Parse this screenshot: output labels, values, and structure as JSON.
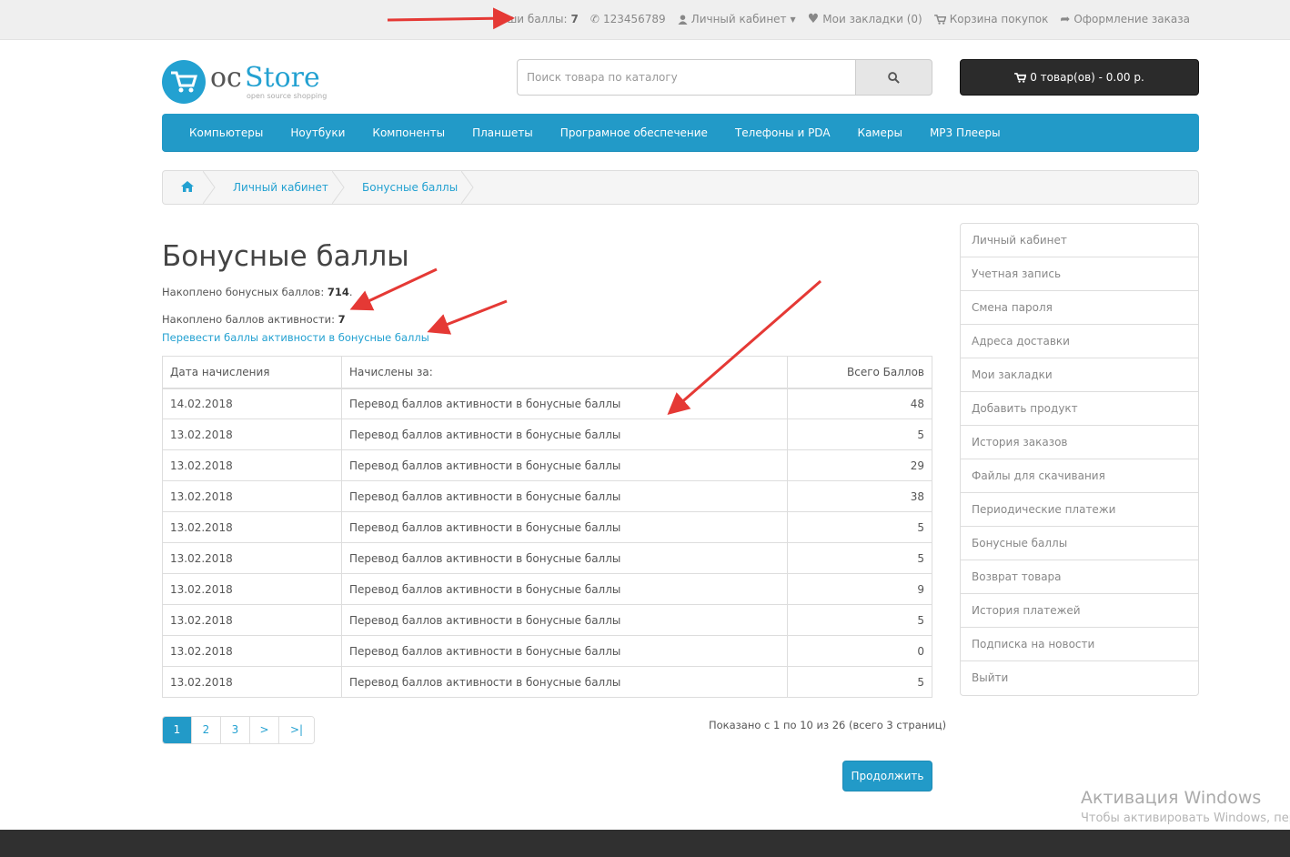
{
  "topbar": {
    "points_label": "Ваши баллы:",
    "points_value": "7",
    "phone": "123456789",
    "account": "Личный кабинет",
    "wishlist": "Мои закладки (0)",
    "cart": "Корзина покупок",
    "checkout": "Оформление заказа"
  },
  "logo": {
    "oc": "oc",
    "store": "Store",
    "tagline": "open source shopping"
  },
  "search": {
    "placeholder": "Поиск товара по каталогу"
  },
  "cart_button": {
    "label": "0 товар(ов) - 0.00 р."
  },
  "menu": [
    "Компьютеры",
    "Ноутбуки",
    "Компоненты",
    "Планшеты",
    "Програмное обеспечение",
    "Телефоны и PDA",
    "Камеры",
    "MP3 Плееры"
  ],
  "breadcrumb": [
    "Личный кабинет",
    "Бонусные баллы"
  ],
  "page": {
    "title": "Бонусные баллы",
    "bonus_label": "Накоплено бонусных баллов:",
    "bonus_value": "714",
    "activity_label": "Накоплено баллов активности:",
    "activity_value": "7",
    "convert_link": "Перевести баллы активности в бонусные баллы"
  },
  "table": {
    "headers": [
      "Дата начисления",
      "Начислены за:",
      "Всего Баллов"
    ],
    "rows": [
      [
        "14.02.2018",
        "Перевод баллов активности в бонусные баллы",
        "48"
      ],
      [
        "13.02.2018",
        "Перевод баллов активности в бонусные баллы",
        "5"
      ],
      [
        "13.02.2018",
        "Перевод баллов активности в бонусные баллы",
        "29"
      ],
      [
        "13.02.2018",
        "Перевод баллов активности в бонусные баллы",
        "38"
      ],
      [
        "13.02.2018",
        "Перевод баллов активности в бонусные баллы",
        "5"
      ],
      [
        "13.02.2018",
        "Перевод баллов активности в бонусные баллы",
        "5"
      ],
      [
        "13.02.2018",
        "Перевод баллов активности в бонусные баллы",
        "9"
      ],
      [
        "13.02.2018",
        "Перевод баллов активности в бонусные баллы",
        "5"
      ],
      [
        "13.02.2018",
        "Перевод баллов активности в бонусные баллы",
        "0"
      ],
      [
        "13.02.2018",
        "Перевод баллов активности в бонусные баллы",
        "5"
      ]
    ]
  },
  "pagination": {
    "pages": [
      "1",
      "2",
      "3",
      ">",
      ">|"
    ],
    "active": "1",
    "summary": "Показано с 1 по 10 из 26 (всего 3 страниц)"
  },
  "continue_button": "Продолжить",
  "sidebar": [
    "Личный кабинет",
    "Учетная запись",
    "Смена пароля",
    "Адреса доставки",
    "Мои закладки",
    "Добавить продукт",
    "История заказов",
    "Файлы для скачивания",
    "Периодические платежи",
    "Бонусные баллы",
    "Возврат товара",
    "История платежей",
    "Подписка на новости",
    "Выйти"
  ],
  "watermark": {
    "line1": "Активация Windows",
    "line2": "Чтобы активировать Windows, перейдите в раздел «Параметры»."
  },
  "colors": {
    "accent": "#229ac8",
    "link": "#23a1d1",
    "annotation_arrow": "#e53935",
    "cart_bg": "#2b2b2b"
  },
  "icons": [
    "phone-icon",
    "user-icon",
    "caret-down-icon",
    "heart-icon",
    "cart-icon",
    "share-icon",
    "search-icon",
    "home-icon"
  ]
}
